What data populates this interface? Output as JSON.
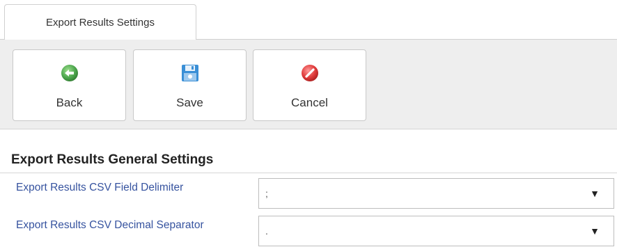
{
  "tabs": [
    {
      "label": "Export Results Settings",
      "active": true
    }
  ],
  "toolbar": {
    "back_label": "Back",
    "save_label": "Save",
    "cancel_label": "Cancel",
    "icons": {
      "back": "back-arrow-icon",
      "save": "floppy-disk-icon",
      "cancel": "cancel-icon"
    },
    "colors": {
      "back": "#4fa84f",
      "save": "#3a8fd6",
      "cancel": "#e03b3b"
    }
  },
  "section": {
    "title": "Export Results General Settings",
    "fields": [
      {
        "label": "Export Results CSV Field Delimiter",
        "value": ";"
      },
      {
        "label": "Export Results CSV Decimal Separator",
        "value": "."
      }
    ]
  },
  "colors": {
    "label": "#36539f",
    "toolbar_bg": "#eeeeee"
  }
}
